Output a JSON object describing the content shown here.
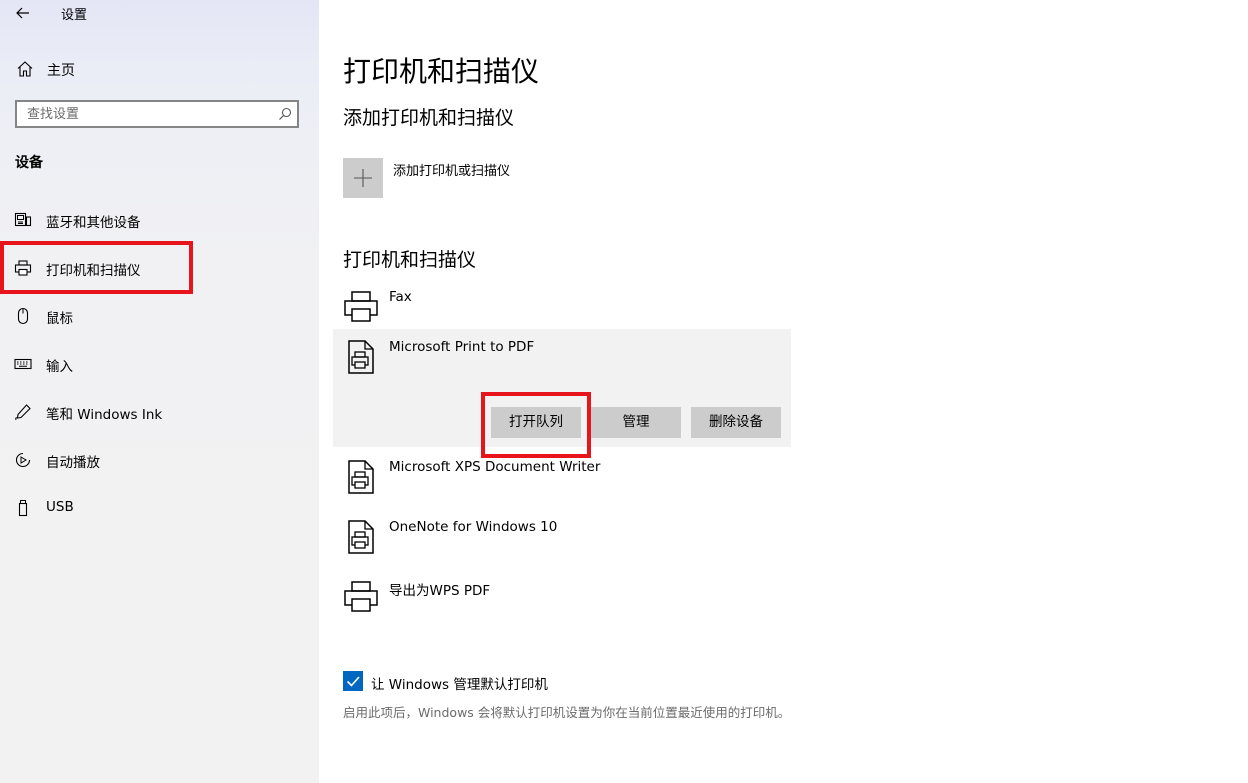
{
  "app": {
    "title": "设置"
  },
  "sidebar": {
    "home_label": "主页",
    "search_placeholder": "查找设置",
    "section": "设备",
    "items": [
      {
        "label": "蓝牙和其他设备",
        "icon": "bluetooth-devices-icon"
      },
      {
        "label": "打印机和扫描仪",
        "icon": "printer-icon"
      },
      {
        "label": "鼠标",
        "icon": "mouse-icon"
      },
      {
        "label": "输入",
        "icon": "keyboard-icon"
      },
      {
        "label": "笔和 Windows Ink",
        "icon": "pen-icon"
      },
      {
        "label": "自动播放",
        "icon": "autoplay-icon"
      },
      {
        "label": "USB",
        "icon": "usb-icon"
      }
    ]
  },
  "main": {
    "title": "打印机和扫描仪",
    "add_section_title": "添加打印机和扫描仪",
    "add_label": "添加打印机或扫描仪",
    "list_title": "打印机和扫描仪",
    "devices": [
      {
        "name": "Fax",
        "icon": "printer-icon"
      },
      {
        "name": "Microsoft Print to PDF",
        "icon": "document-printer-icon"
      },
      {
        "name": "Microsoft XPS Document Writer",
        "icon": "document-printer-icon"
      },
      {
        "name": "OneNote for Windows 10",
        "icon": "document-printer-icon"
      },
      {
        "name": "导出为WPS PDF",
        "icon": "printer-icon"
      }
    ],
    "actions": {
      "open_queue": "打开队列",
      "manage": "管理",
      "remove": "删除设备"
    },
    "default_printer": {
      "checked": true,
      "label": "让 Windows 管理默认打印机",
      "note": "启用此项后，Windows 会将默认打印机设置为你在当前位置最近使用的打印机。"
    }
  },
  "colors": {
    "accent": "#0067c0",
    "highlight": "#e8141c",
    "button": "#cccccc",
    "selected_row": "#f2f2f2"
  }
}
